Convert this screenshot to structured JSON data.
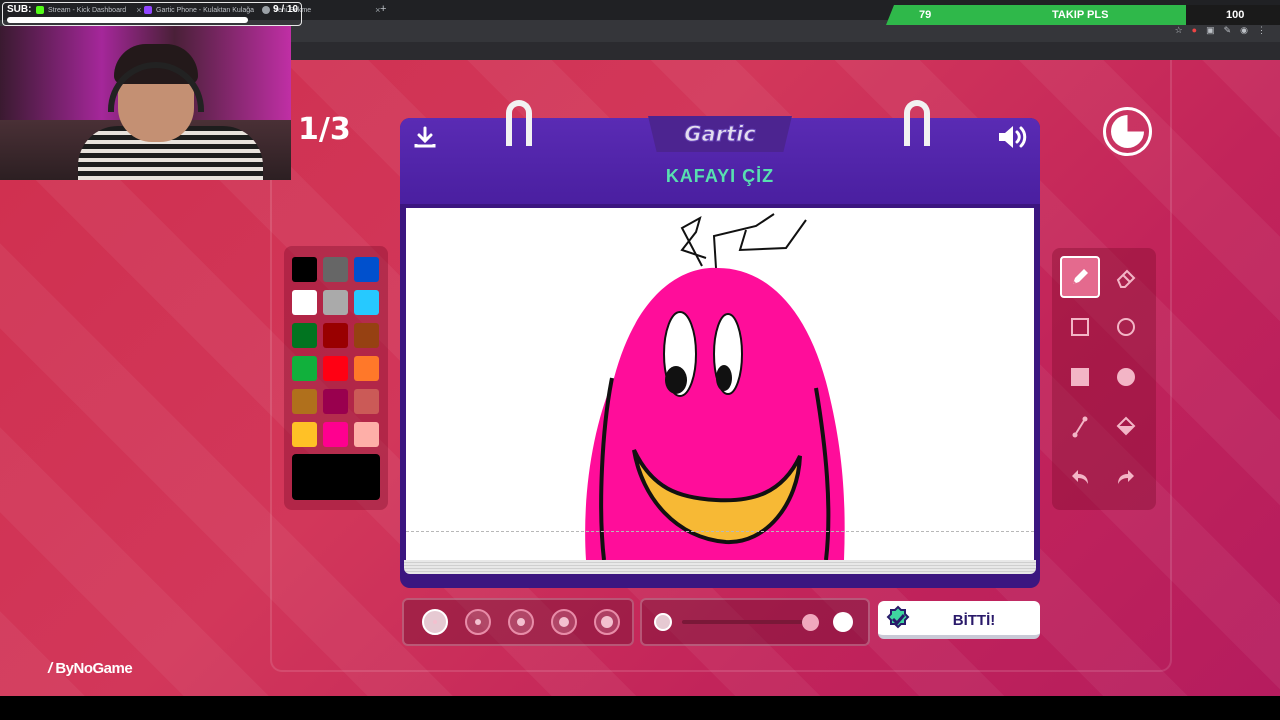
{
  "browser": {
    "tabs": [
      {
        "label": "Stream - Kick Dashboard",
        "icon_color": "#53fc18"
      },
      {
        "label": "Gartic Phone - Kulaktan Kulağa",
        "icon_color": "#9146ff"
      },
      {
        "label": "Yeni Sekme",
        "icon_color": "#9aa0a6"
      }
    ],
    "new_tab_label": "+",
    "close_label": "×"
  },
  "stream": {
    "sub_label": "SUB:",
    "sub_count": "9 / 10",
    "sub_progress": 0.9,
    "follow_current": "79",
    "follow_label": "TAKIP PLS",
    "follow_goal": "100",
    "watermark": "ByNoGame"
  },
  "game": {
    "round": "1/3",
    "logo": "Gartic",
    "task": "KAFAYI ÇİZ",
    "timer_remaining": 0.75,
    "done_label": "BİTTİ!",
    "colors": [
      "#000000",
      "#666666",
      "#0050cd",
      "#ffffff",
      "#aaaaaa",
      "#26c9ff",
      "#017420",
      "#990000",
      "#964112",
      "#11b03c",
      "#ff0013",
      "#ff7829",
      "#b0701c",
      "#99004e",
      "#cb5a57",
      "#ffc126",
      "#ff008f",
      "#feafa8"
    ],
    "current_color": "#000000",
    "brush_sizes": [
      1,
      2,
      3,
      4,
      5
    ],
    "selected_brush": 1,
    "opacity": 0.95,
    "tools": [
      "pencil-icon",
      "eraser-icon",
      "rect-outline-icon",
      "circle-outline-icon",
      "rect-filled-icon",
      "circle-filled-icon",
      "line-icon",
      "fill-bucket-icon",
      "undo-icon",
      "redo-icon"
    ],
    "selected_tool": "pencil-icon"
  }
}
